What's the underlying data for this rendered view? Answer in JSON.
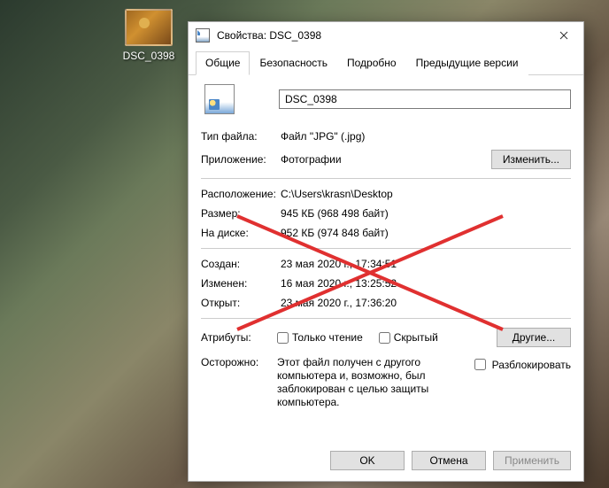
{
  "desktop": {
    "icon_label": "DSC_0398"
  },
  "dialog": {
    "title": "Свойства: DSC_0398",
    "tabs": {
      "general": "Общие",
      "security": "Безопасность",
      "details": "Подробно",
      "previous": "Предыдущие версии"
    },
    "filename": "DSC_0398",
    "type_label": "Тип файла:",
    "type_value": "Файл \"JPG\" (.jpg)",
    "app_label": "Приложение:",
    "app_value": "Фотографии",
    "change_btn": "Изменить...",
    "location_label": "Расположение:",
    "location_value": "C:\\Users\\krasn\\Desktop",
    "size_label": "Размер:",
    "size_value": "945 КБ (968 498 байт)",
    "ondisk_label": "На диске:",
    "ondisk_value": "952 КБ (974 848 байт)",
    "created_label": "Создан:",
    "created_value": "23 мая 2020 г., 17:34:51",
    "modified_label": "Изменен:",
    "modified_value": "16 мая 2020 г., 13:25:52",
    "accessed_label": "Открыт:",
    "accessed_value": "23 мая 2020 г., 17:36:20",
    "attributes_label": "Атрибуты:",
    "readonly_label": "Только чтение",
    "hidden_label": "Скрытый",
    "other_btn": "Другие...",
    "caution_label": "Осторожно:",
    "caution_text": "Этот файл получен с другого компьютера и, возможно, был заблокирован с целью защиты компьютера.",
    "unblock_label": "Разблокировать",
    "ok": "OK",
    "cancel": "Отмена",
    "apply": "Применить"
  }
}
